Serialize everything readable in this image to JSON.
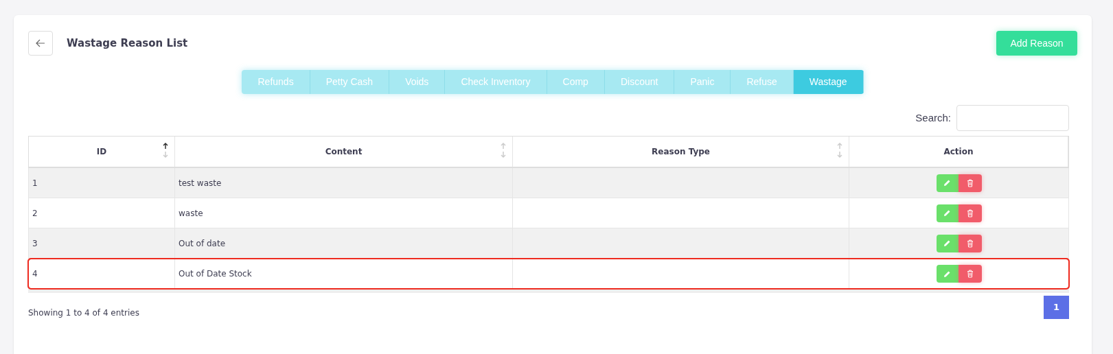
{
  "header": {
    "title": "Wastage Reason List",
    "add_button": "Add Reason"
  },
  "tabs": [
    {
      "label": "Refunds",
      "selected": false
    },
    {
      "label": "Petty Cash",
      "selected": false
    },
    {
      "label": "Voids",
      "selected": false
    },
    {
      "label": "Check Inventory",
      "selected": false
    },
    {
      "label": "Comp",
      "selected": false
    },
    {
      "label": "Discount",
      "selected": false
    },
    {
      "label": "Panic",
      "selected": false
    },
    {
      "label": "Refuse",
      "selected": false
    },
    {
      "label": "Wastage",
      "selected": true
    }
  ],
  "search": {
    "label": "Search:"
  },
  "table": {
    "columns": [
      {
        "label": "ID",
        "sorted": true
      },
      {
        "label": "Content",
        "sorted": false
      },
      {
        "label": "Reason Type",
        "sorted": false
      },
      {
        "label": "Action"
      }
    ],
    "rows": [
      {
        "id": "1",
        "content": "test waste",
        "highlighted": false
      },
      {
        "id": "2",
        "content": "waste",
        "highlighted": false
      },
      {
        "id": "3",
        "content": "Out of date",
        "highlighted": false
      },
      {
        "id": "4",
        "content": "Out of Date Stock",
        "highlighted": true
      }
    ]
  },
  "footer": {
    "info": "Showing 1 to 4 of 4 entries",
    "pages": [
      {
        "label": "1",
        "selected": true
      }
    ]
  }
}
